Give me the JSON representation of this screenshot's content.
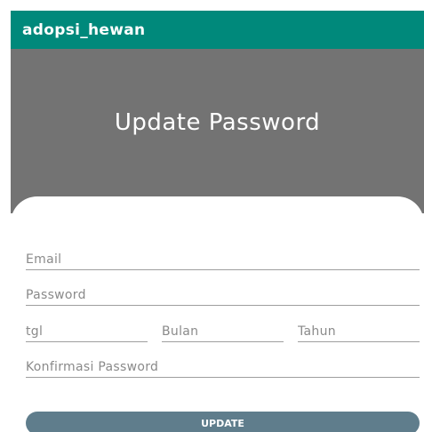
{
  "appbar": {
    "title": "adopsi_hewan",
    "color": "#00897b"
  },
  "hero": {
    "title": "Update Password",
    "color": "#737373"
  },
  "form": {
    "email_placeholder": "Email",
    "password_placeholder": "Password",
    "day_placeholder": "tgl",
    "month_placeholder": "Bulan",
    "year_placeholder": "Tahun",
    "confirm_placeholder": "Konfirmasi Password"
  },
  "button": {
    "label": "UPDATE",
    "color": "#5f7d8c"
  }
}
